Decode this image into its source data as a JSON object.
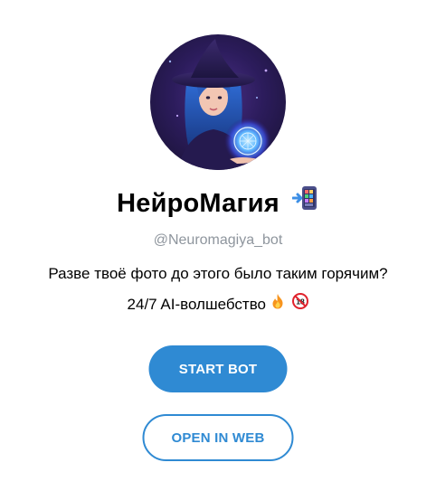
{
  "bot": {
    "name": "НейроМагия",
    "name_emoji": "calculator-phone-icon",
    "username": "@Neuromagiya_bot",
    "description_line1": "Разве твоё фото до этого было таким горячим?",
    "description_line2": "24/7 AI-волшебство",
    "description_emojis": [
      "fire-icon",
      "18-plus-icon"
    ]
  },
  "actions": {
    "start_label": "START BOT",
    "web_label": "OPEN IN WEB"
  },
  "colors": {
    "accent": "#2f8ad3",
    "muted_text": "#8e959d",
    "background": "#ffffff"
  }
}
